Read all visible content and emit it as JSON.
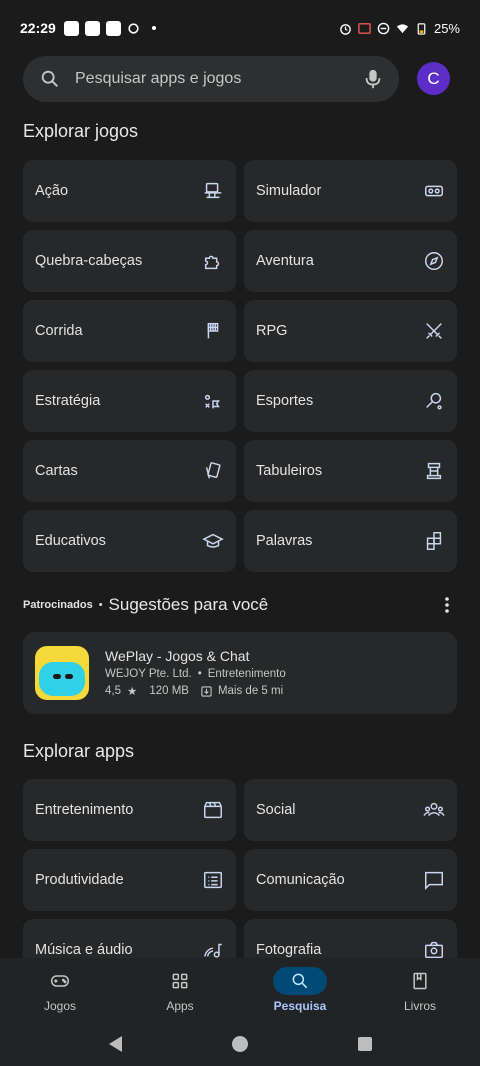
{
  "status_bar": {
    "time": "22:29",
    "battery": "25%"
  },
  "search": {
    "placeholder": "Pesquisar apps e jogos",
    "avatar_letter": "C"
  },
  "games_section": {
    "title": "Explorar jogos",
    "categories": [
      {
        "label": "Ação",
        "icon": "action-icon"
      },
      {
        "label": "Simulador",
        "icon": "vr-headset-icon"
      },
      {
        "label": "Quebra-cabeças",
        "icon": "puzzle-icon"
      },
      {
        "label": "Aventura",
        "icon": "compass-icon"
      },
      {
        "label": "Corrida",
        "icon": "checkered-flag-icon"
      },
      {
        "label": "RPG",
        "icon": "crossed-swords-icon"
      },
      {
        "label": "Estratégia",
        "icon": "strategy-icon"
      },
      {
        "label": "Esportes",
        "icon": "racket-icon"
      },
      {
        "label": "Cartas",
        "icon": "cards-icon"
      },
      {
        "label": "Tabuleiros",
        "icon": "chess-rook-icon"
      },
      {
        "label": "Educativos",
        "icon": "graduation-cap-icon"
      },
      {
        "label": "Palavras",
        "icon": "word-tiles-icon"
      }
    ]
  },
  "sponsored": {
    "tag": "Patrocinados",
    "separator": "•",
    "title": "Sugestões para você",
    "app": {
      "name": "WePlay - Jogos & Chat",
      "developer": "WEJOY Pte. Ltd.",
      "category": "Entretenimento",
      "rating": "4,5",
      "size": "120 MB",
      "downloads": "Mais de 5 mi"
    }
  },
  "apps_section": {
    "title": "Explorar apps",
    "categories": [
      {
        "label": "Entretenimento",
        "icon": "clapperboard-icon"
      },
      {
        "label": "Social",
        "icon": "people-icon"
      },
      {
        "label": "Produtividade",
        "icon": "list-icon"
      },
      {
        "label": "Comunicação",
        "icon": "chat-bubble-icon"
      },
      {
        "label": "Música e áudio",
        "icon": "music-icon"
      },
      {
        "label": "Fotografia",
        "icon": "camera-icon"
      }
    ]
  },
  "bottom_nav": [
    {
      "label": "Jogos",
      "icon": "gamepad-icon",
      "active": false
    },
    {
      "label": "Apps",
      "icon": "apps-grid-icon",
      "active": false
    },
    {
      "label": "Pesquisa",
      "icon": "search-icon",
      "active": true
    },
    {
      "label": "Livros",
      "icon": "book-icon",
      "active": false
    }
  ]
}
